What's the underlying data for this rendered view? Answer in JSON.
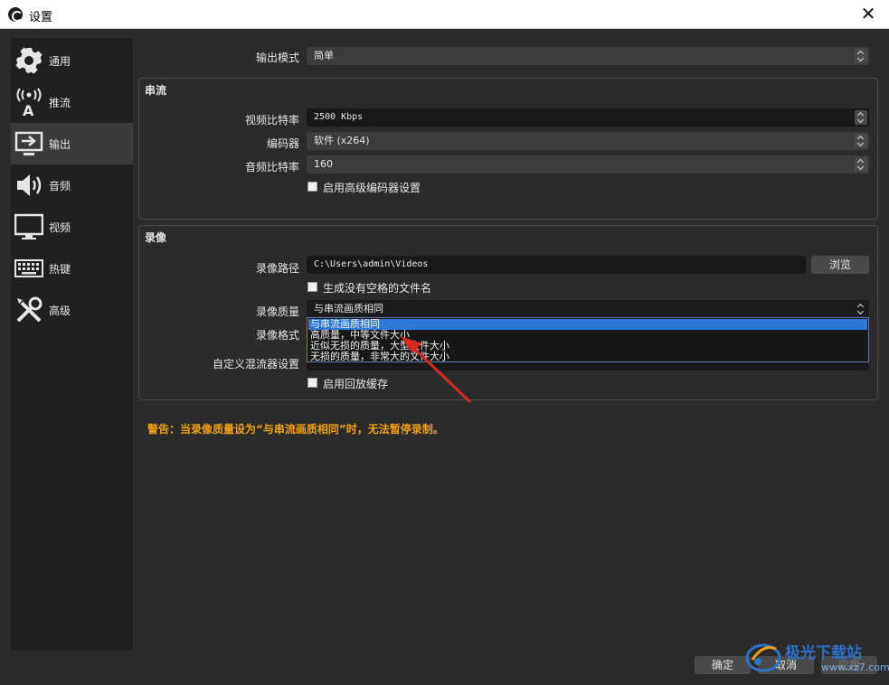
{
  "window": {
    "title": "设置",
    "close_symbol": "✕"
  },
  "sidebar": {
    "items": [
      {
        "label": "通用",
        "icon": "gear-icon"
      },
      {
        "label": "推流",
        "icon": "antenna-icon"
      },
      {
        "label": "输出",
        "icon": "output-icon",
        "active": true
      },
      {
        "label": "音频",
        "icon": "speaker-icon"
      },
      {
        "label": "视频",
        "icon": "monitor-icon"
      },
      {
        "label": "热键",
        "icon": "keyboard-icon"
      },
      {
        "label": "高级",
        "icon": "tools-icon"
      }
    ]
  },
  "output_mode": {
    "label": "输出模式",
    "value": "简单"
  },
  "streaming": {
    "title": "串流",
    "video_bitrate": {
      "label": "视频比特率",
      "value": "2500 Kbps"
    },
    "encoder": {
      "label": "编码器",
      "value": "软件 (x264)"
    },
    "audio_bitrate": {
      "label": "音频比特率",
      "value": "160"
    },
    "advanced_encoder": {
      "label": "启用高级编码器设置",
      "checked": false
    }
  },
  "recording": {
    "title": "录像",
    "path": {
      "label": "录像路径",
      "value": "C:\\Users\\admin\\Videos",
      "browse": "浏览"
    },
    "no_space_filename": {
      "label": "生成没有空格的文件名",
      "checked": false
    },
    "quality": {
      "label": "录像质量",
      "value": "与串流画质相同",
      "options": [
        "与串流画质相同",
        "高质量，中等文件大小",
        "近似无损的质量，大型文件大小",
        "无损的质量，非常大的文件大小"
      ],
      "selected_index": 0
    },
    "format": {
      "label": "录像格式"
    },
    "custom_muxer": {
      "label": "自定义混流器设置"
    },
    "replay_buffer": {
      "label": "启用回放缓存",
      "checked": false
    }
  },
  "warning": "警告：当录像质量设为“与串流画质相同”时，无法暂停录制。",
  "footer": {
    "ok": "确定",
    "cancel": "取消",
    "apply": "应用"
  },
  "watermark": {
    "text": "极光下载站",
    "url": "www.xz7.com"
  },
  "colors": {
    "warning": "#f0a015",
    "selected": "#2f78d6",
    "annotation_arrow": "#d8281f"
  }
}
